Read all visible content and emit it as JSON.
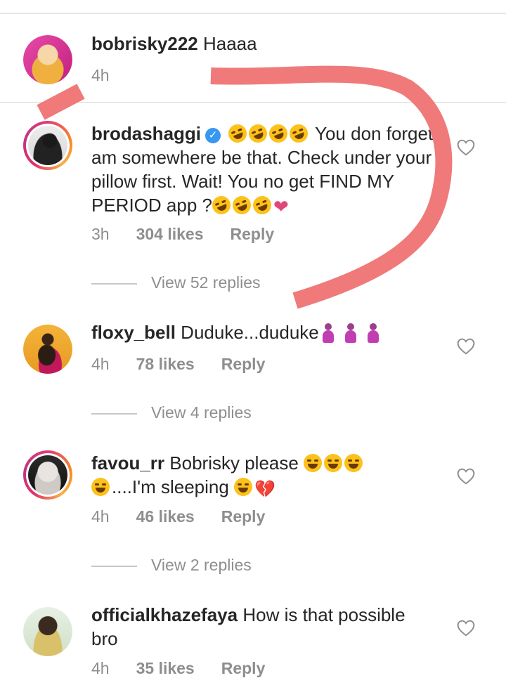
{
  "comments": [
    {
      "username": "bobrisky222",
      "text": "Haaaa",
      "time": "4h"
    },
    {
      "username": "brodashaggi",
      "verified": true,
      "text": "You don forget am somewhere be that. Check under your pillow first. Wait! You no get FIND MY PERIOD app ?",
      "time": "3h",
      "likes": "304 likes",
      "reply": "Reply",
      "view_replies": "View 52 replies"
    },
    {
      "username": "floxy_bell",
      "text": "Duduke...duduke",
      "time": "4h",
      "likes": "78 likes",
      "reply": "Reply",
      "view_replies": "View 4 replies"
    },
    {
      "username": "favou_rr",
      "text_1": "Bobrisky please",
      "text_2": "....I'm sleeping",
      "time": "4h",
      "likes": "46 likes",
      "reply": "Reply",
      "view_replies": "View 2 replies"
    },
    {
      "username": "officialkhazefaya",
      "text": "How is that possible bro",
      "time": "4h",
      "likes": "35 likes",
      "reply": "Reply"
    }
  ],
  "icons": {
    "like": "heart-outline-icon",
    "verified": "verified-badge-icon"
  },
  "colors": {
    "annotation": "#f07a7a",
    "verified": "#3897f0",
    "meta_text": "#8e8e8e"
  }
}
